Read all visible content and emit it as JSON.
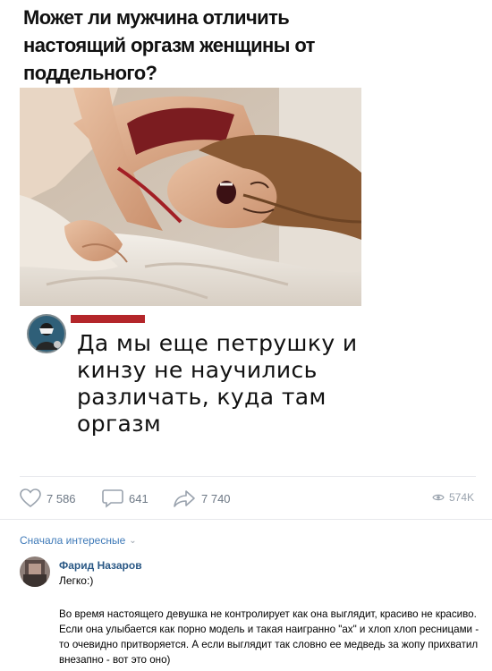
{
  "meme": {
    "title": "Может ли мужчина отличить настоящий оргазм женщины от поддельного?",
    "reply_text": "Да мы еще петрушку и кинзу не научились различать, куда там оргазм"
  },
  "actions": {
    "likes": "7 586",
    "comments": "641",
    "shares": "7 740",
    "views": "574K",
    "colors": {
      "icon": "#99a2ad",
      "text": "#6d7885"
    }
  },
  "comments_section": {
    "sort_label": "Сначала интересные",
    "comment": {
      "author": "Фарид Назаров",
      "first_line": "Легко:)",
      "body": "Во время настоящего девушка не контролирует как она выглядит, красиво не красиво. Если она улыбается как порно модель и такая наигранно \"ах\" и хлоп хлоп ресницами - то очевидно притворяется. А если выглядит так словно ее медведь за жопу прихватил внезапно - вот это оно)"
    }
  },
  "colors": {
    "link": "#2a5885",
    "accent_link": "#3f7ab8",
    "redaction": "#b4262a",
    "divider": "#e7e8ec"
  }
}
